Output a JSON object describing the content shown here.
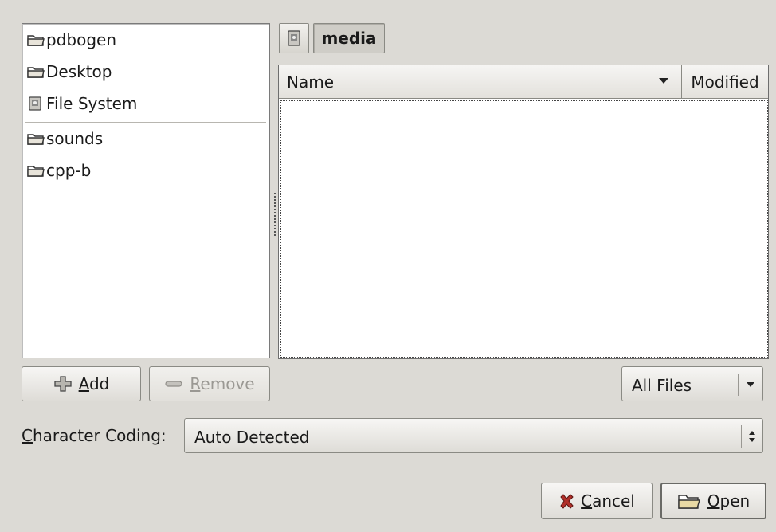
{
  "places": {
    "items": [
      {
        "label": "pdbogen",
        "icon": "folder-icon"
      },
      {
        "label": "Desktop",
        "icon": "folder-icon"
      },
      {
        "label": "File System",
        "icon": "drive-icon"
      }
    ],
    "bookmarks": [
      {
        "label": "sounds",
        "icon": "folder-icon"
      },
      {
        "label": "cpp-b",
        "icon": "folder-icon"
      }
    ]
  },
  "path_bar": {
    "current": "media",
    "toggle_icon": "drive-icon"
  },
  "file_list": {
    "columns": [
      "Name",
      "Modified"
    ],
    "sort_column": "Name",
    "rows": []
  },
  "buttons": {
    "add": {
      "mnemonic": "A",
      "rest": "dd"
    },
    "remove": {
      "mnemonic": "R",
      "rest": "emove"
    },
    "cancel": {
      "mnemonic": "C",
      "rest": "ancel"
    },
    "open": {
      "mnemonic": "O",
      "rest": "pen"
    }
  },
  "filter": {
    "value": "All Files"
  },
  "character_coding": {
    "label_mnemonic": "C",
    "label_rest": "haracter Coding:",
    "value": "Auto Detected"
  },
  "colors": {
    "background": "#dcdad5",
    "folder": "#e8d9a4",
    "cancel_icon": "#b0302a"
  }
}
